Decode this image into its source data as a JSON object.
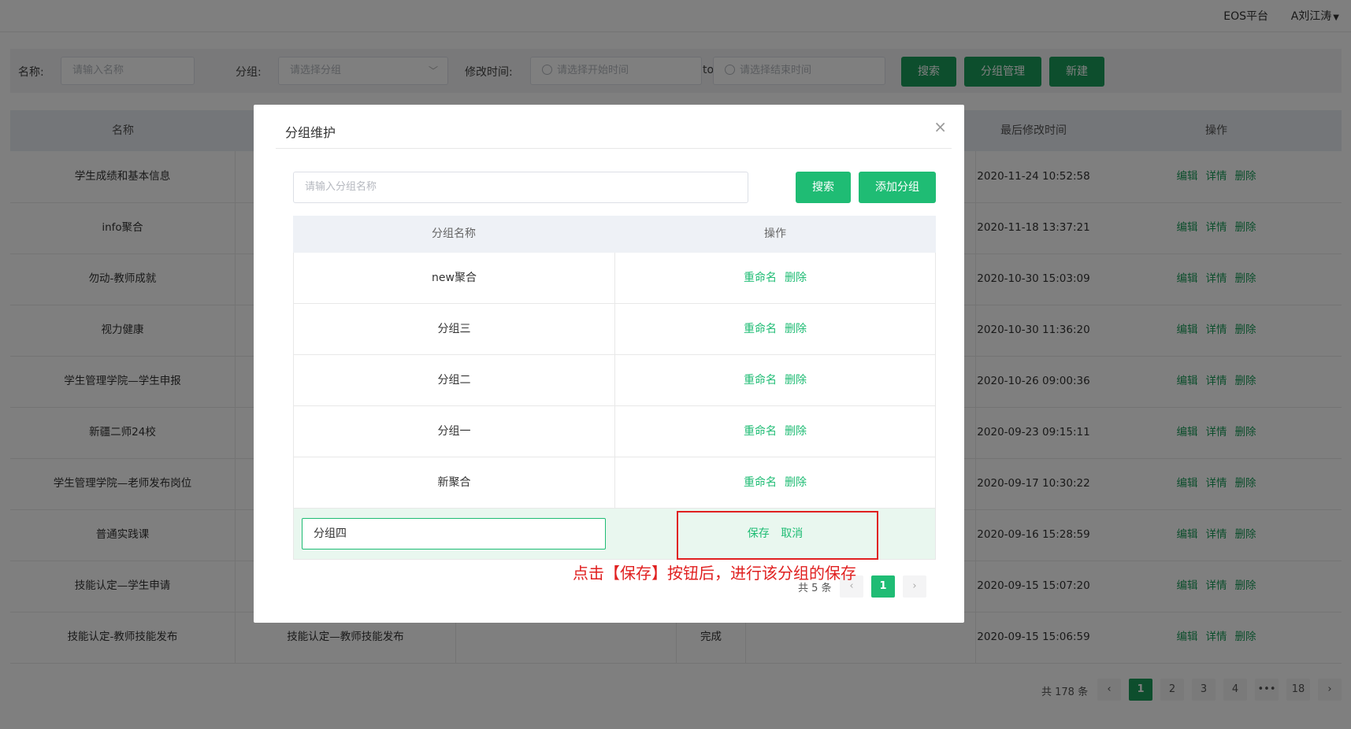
{
  "topbar": {
    "platform": "EOS平台",
    "user": "A刘江涛"
  },
  "filters": {
    "name_label": "名称:",
    "name_placeholder": "请输入名称",
    "group_label": "分组:",
    "group_placeholder": "请选择分组",
    "time_label": "修改时间:",
    "start_placeholder": "请选择开始时间",
    "to": "to",
    "end_placeholder": "请选择结束时间",
    "search": "搜索",
    "group_manage": "分组管理",
    "create": "新建"
  },
  "table": {
    "headers": [
      "名称",
      "最后修改时间",
      "操作"
    ],
    "ops": {
      "edit": "编辑",
      "detail": "详情",
      "delete": "删除"
    },
    "rows": [
      {
        "name": "学生成绩和基本信息",
        "time": "2020-11-24 10:52:58"
      },
      {
        "name": "info聚合",
        "time": "2020-11-18 13:37:21"
      },
      {
        "name": "勿动-教师成就",
        "time": "2020-10-30 15:03:09"
      },
      {
        "name": "视力健康",
        "time": "2020-10-30 11:36:20"
      },
      {
        "name": "学生管理学院—学生申报",
        "time": "2020-10-26 09:00:36"
      },
      {
        "name": "新疆二师24校",
        "time": "2020-09-23 09:15:11"
      },
      {
        "name": "学生管理学院—老师发布岗位",
        "time": "2020-09-17 10:30:22"
      },
      {
        "name": "普通实践课",
        "time": "2020-09-16 15:28:59"
      },
      {
        "name": "技能认定—学生申请",
        "time": "2020-09-15 15:07:20"
      },
      {
        "name": "技能认定-教师技能发布",
        "group": "技能认定—教师技能发布",
        "status": "完成",
        "time": "2020-09-15 15:06:59"
      }
    ]
  },
  "pagination": {
    "total": "共 178 条",
    "pages": [
      "1",
      "2",
      "3",
      "4",
      "•••",
      "18"
    ],
    "prev": "‹",
    "next": "›"
  },
  "dialog": {
    "title": "分组维护",
    "close": "×",
    "search_placeholder": "请输入分组名称",
    "search": "搜索",
    "add": "添加分组",
    "headers": [
      "分组名称",
      "操作"
    ],
    "rename": "重命名",
    "delete": "删除",
    "groups": [
      "new聚合",
      "分组三",
      "分组二",
      "分组一",
      "新聚合"
    ],
    "edit_value": "分组四",
    "save": "保存",
    "cancel": "取消",
    "annotation": "点击【保存】按钮后，进行该分组的保存",
    "total": "共 5 条",
    "page": "1",
    "prev": "‹",
    "next": "›"
  },
  "colors": {
    "primary": "#1a9d5a",
    "dialog_primary": "#1fbc74",
    "annotation": "#e02020"
  }
}
